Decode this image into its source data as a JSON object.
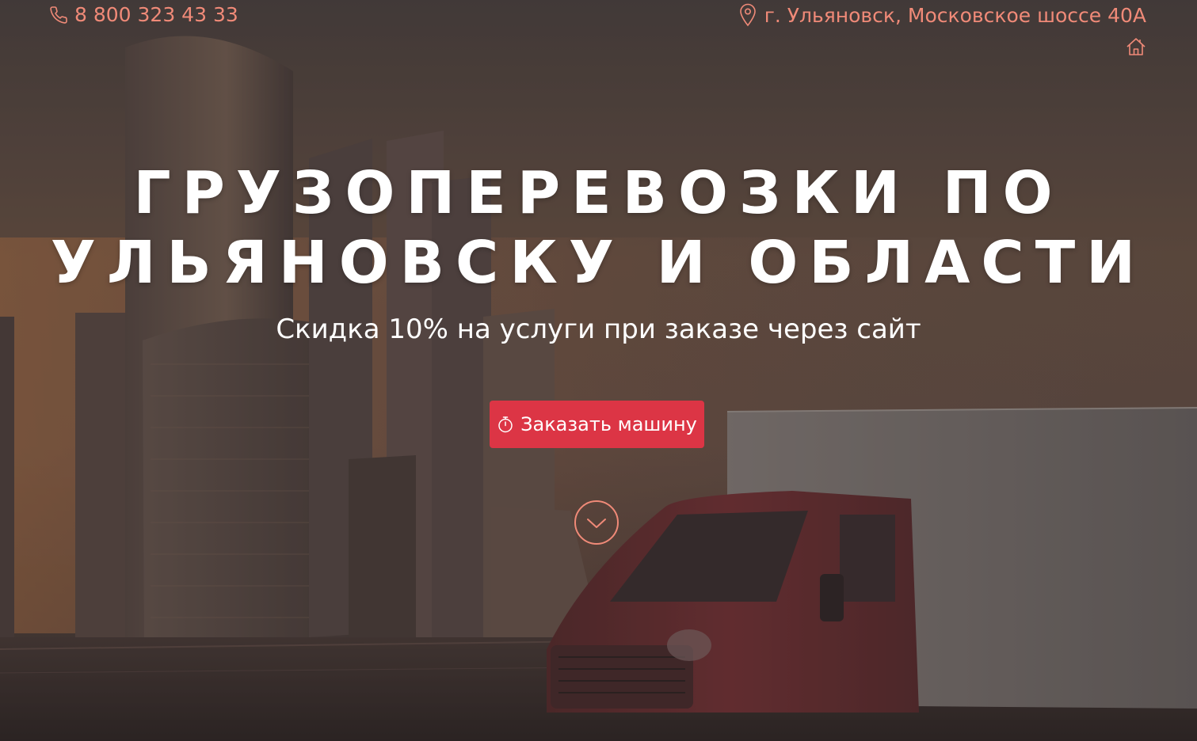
{
  "topbar": {
    "phone": "8 800 323 43 33",
    "address": "г. Ульяновск, Московское шоссе 40А"
  },
  "hero": {
    "headline_line1": "Грузоперевозки по",
    "headline_line2": "Ульяновску и области",
    "subtitle": "Скидка 10% на услуги при заказе через сайт",
    "order_button_label": "Заказать машину"
  },
  "icons": {
    "phone": "phone-icon",
    "address": "map-pin-icon",
    "home": "home-icon",
    "button": "stopwatch-icon",
    "scroll": "chevron-down-circle-icon"
  },
  "colors": {
    "accent": "#f08a78",
    "button": "#dc3545",
    "text": "#ffffff"
  }
}
